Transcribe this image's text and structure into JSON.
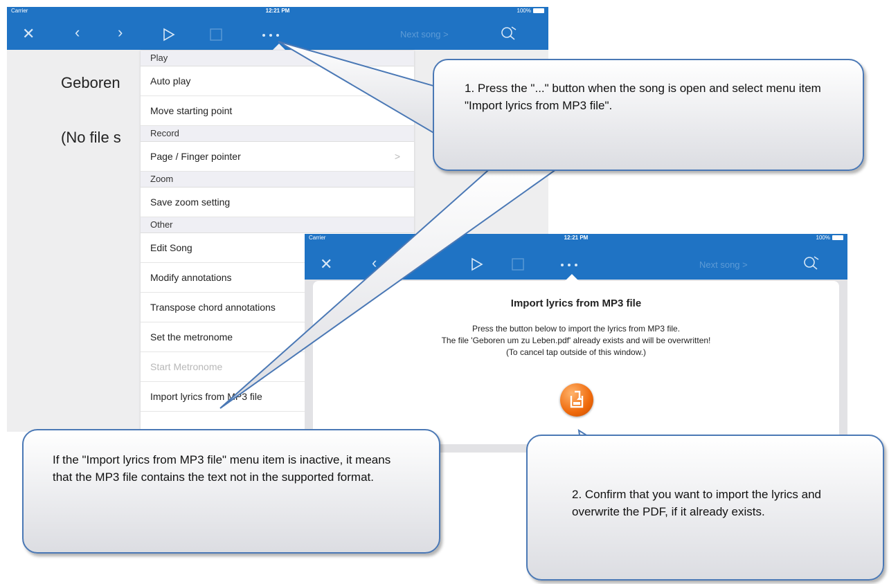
{
  "status_bar": {
    "carrier": "Carrier",
    "time": "12:21 PM",
    "battery": "100%"
  },
  "toolbar": {
    "next_song": "Next song >",
    "icons": [
      "close-icon",
      "back-icon",
      "forward-icon",
      "play-icon",
      "stop-icon",
      "more-icon",
      "search-icon"
    ]
  },
  "song": {
    "title_partial": "Geboren",
    "no_file_partial": "(No file s"
  },
  "menu": {
    "sections": [
      {
        "header": "Play",
        "items": [
          {
            "label": "Auto play"
          },
          {
            "label": "Move starting point"
          }
        ]
      },
      {
        "header": "Record",
        "items": [
          {
            "label": "Page / Finger pointer",
            "chevron": ">"
          }
        ]
      },
      {
        "header": "Zoom",
        "items": [
          {
            "label": "Save zoom setting"
          }
        ]
      },
      {
        "header": "Other",
        "items": [
          {
            "label": "Edit Song"
          },
          {
            "label": "Modify annotations"
          },
          {
            "label": "Transpose chord annotations"
          },
          {
            "label": "Set the metronome"
          },
          {
            "label": "Start Metronome",
            "disabled": true
          },
          {
            "label": "Import lyrics from MP3 file"
          }
        ]
      }
    ]
  },
  "dialog": {
    "title": "Import lyrics from MP3 file",
    "line1": "Press the button below to import the lyrics from MP3 file.",
    "line2": "The file 'Geboren um zu Leben.pdf' already exists and will be overwritten!",
    "line3": "(To cancel tap outside of this window.)",
    "button_icon": "import-icon"
  },
  "callouts": {
    "step1": "1. Press the \"...\" button when the song is open and select menu item \"Import lyrics from MP3 file\".",
    "step2": "2. Confirm that you want to import the lyrics and overwrite the PDF, if it already exists.",
    "inactive_note": "If the \"Import lyrics from MP3 file\" menu item is inactive, it means that the MP3 file contains the text not in the supported format."
  },
  "colors": {
    "toolbar_blue": "#1f73c4",
    "callout_border": "#4a78b5",
    "button_orange": "#ef6a0c"
  }
}
